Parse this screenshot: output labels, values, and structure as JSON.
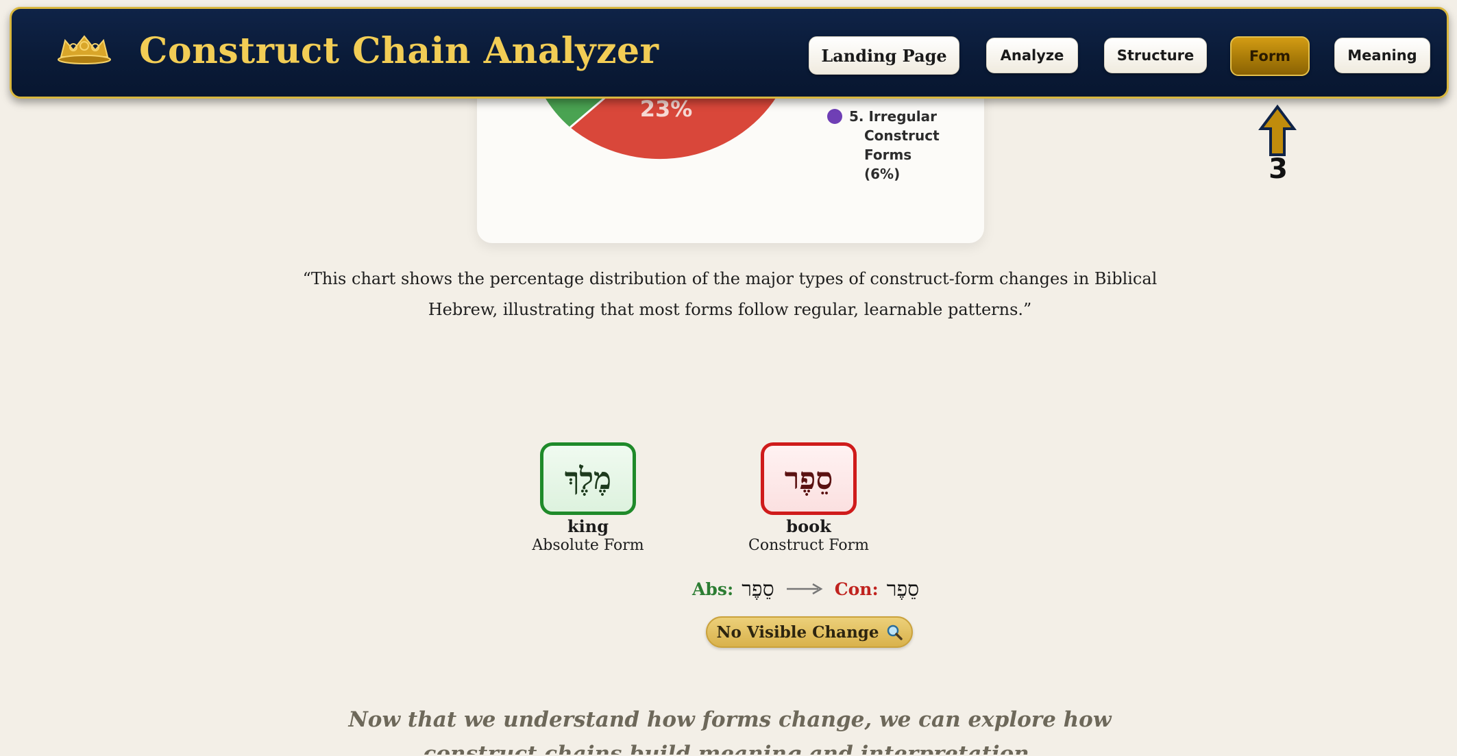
{
  "header": {
    "title": "Construct Chain Analyzer",
    "logo_icon": "crown-logo-icon",
    "nav": [
      {
        "label": "Landing Page",
        "active": false
      },
      {
        "label": "Analyze",
        "active": false
      },
      {
        "label": "Structure",
        "active": false
      },
      {
        "label": "Form",
        "active": true
      },
      {
        "label": "Meaning",
        "active": false
      }
    ]
  },
  "annotation": {
    "number": "3"
  },
  "chart": {
    "slice_label": "23%",
    "legend": {
      "number": "5.",
      "lines": [
        "Irregular",
        "Construct Forms",
        "(6%)"
      ]
    }
  },
  "chart_data": {
    "type": "pie",
    "title": "",
    "labels": [
      "Irregular Construct Forms"
    ],
    "values": [
      6
    ],
    "visible_slice_labels": [
      "23%"
    ],
    "colors": {
      "red": "#d9473a",
      "green": "#4aa352",
      "purple": "#6f3fb5"
    }
  },
  "caption": {
    "line1": "“This chart shows the percentage distribution of the major types of construct-form changes in Biblical",
    "line2": "Hebrew, illustrating that most forms follow regular, learnable patterns.”"
  },
  "words": {
    "absolute": {
      "hebrew": "מֶלֶךְ",
      "gloss": "king",
      "form": "Absolute Form"
    },
    "construct": {
      "hebrew": "סֵפֶר",
      "gloss": "book",
      "form": "Construct Form"
    }
  },
  "transform": {
    "abs_label": "Abs:",
    "abs_word": "סֵפֶר",
    "con_label": "Con:",
    "con_word": "סֵפֶר"
  },
  "badge": {
    "label": "No Visible Change",
    "icon": "search-icon"
  },
  "transition": {
    "line1": "Now that we understand how forms change, we can explore how",
    "line2": "construct chains build meaning and interpretation."
  },
  "colors": {
    "header_bg": "#0a1b38",
    "header_border": "#d9b73e",
    "title_gold": "#f2cd55",
    "active_nav": "#a97b08",
    "page_bg": "#f3efe7"
  }
}
